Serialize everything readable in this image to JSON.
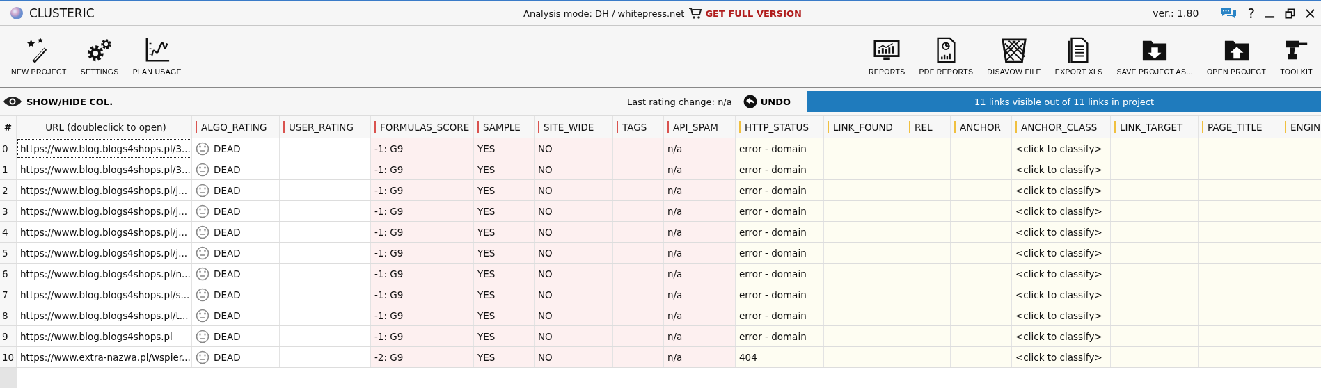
{
  "window": {
    "title": "CLUSTERIC",
    "mode": "Analysis mode: DH / whitepress.net",
    "promo": "GET FULL VERSION",
    "version": "ver.: 1.80",
    "help": "?"
  },
  "toolbar_left": [
    {
      "label": "NEW PROJECT",
      "kind": "wand"
    },
    {
      "label": "SETTINGS",
      "kind": "gears"
    },
    {
      "label": "PLAN USAGE",
      "kind": "chart"
    }
  ],
  "toolbar_right": [
    {
      "label": "REPORTS",
      "kind": "monitor"
    },
    {
      "label": "PDF REPORTS",
      "kind": "pdf"
    },
    {
      "label": "DISAVOW FILE",
      "kind": "bin"
    },
    {
      "label": "EXPORT XLS",
      "kind": "doc"
    },
    {
      "label": "SAVE PROJECT AS...",
      "kind": "save"
    },
    {
      "label": "OPEN PROJECT",
      "kind": "open"
    },
    {
      "label": "TOOLKIT",
      "kind": "drill"
    }
  ],
  "show_hide": "SHOW/HIDE COL.",
  "last_rating": "Last rating change: n/a",
  "undo": "UNDO",
  "links_banner": "11 links visible out of 11 links in project",
  "table": {
    "columns": [
      {
        "label": "#",
        "kind": "index"
      },
      {
        "label": "URL (doubleclick to open)",
        "kind": "plain"
      },
      {
        "label": "ALGO_RATING",
        "kind": "plain",
        "color": "#d9534f"
      },
      {
        "label": "USER_RATING",
        "kind": "plain",
        "color": "#d9534f"
      },
      {
        "label": "FORMULAS_SCORE",
        "kind": "score",
        "color": "#d9534f"
      },
      {
        "label": "SAMPLE",
        "kind": "score",
        "color": "#d9534f"
      },
      {
        "label": "SITE_WIDE",
        "kind": "score",
        "color": "#d9534f"
      },
      {
        "label": "TAGS",
        "kind": "score",
        "color": "#d9534f"
      },
      {
        "label": "API_SPAM",
        "kind": "score",
        "color": "#d9534f"
      },
      {
        "label": "HTTP_STATUS",
        "kind": "crawl",
        "color": "#f0c040"
      },
      {
        "label": "LINK_FOUND",
        "kind": "crawl",
        "color": "#f0c040"
      },
      {
        "label": "REL",
        "kind": "crawl",
        "color": "#f0c040"
      },
      {
        "label": "ANCHOR",
        "kind": "crawl",
        "color": "#f0c040"
      },
      {
        "label": "ANCHOR_CLASS",
        "kind": "crawl",
        "color": "#f0c040"
      },
      {
        "label": "LINK_TARGET",
        "kind": "crawl",
        "color": "#f0c040"
      },
      {
        "label": "PAGE_TITLE",
        "kind": "crawl",
        "color": "#f0c040"
      },
      {
        "label": "ENGIN",
        "kind": "crawl",
        "color": "#f0c040"
      }
    ],
    "rows": [
      {
        "focused": true,
        "cells": [
          "0",
          "https://www.blog.blogs4shops.pl/3...",
          "DEAD",
          "",
          "-1: G9",
          "YES",
          "NO",
          "",
          "n/a",
          "error - domain",
          "",
          "",
          "",
          "<click to classify>",
          "",
          "",
          ""
        ]
      },
      {
        "focused": false,
        "cells": [
          "1",
          "https://www.blog.blogs4shops.pl/3...",
          "DEAD",
          "",
          "-1: G9",
          "YES",
          "NO",
          "",
          "n/a",
          "error - domain",
          "",
          "",
          "",
          "<click to classify>",
          "",
          "",
          ""
        ]
      },
      {
        "focused": false,
        "cells": [
          "2",
          "https://www.blog.blogs4shops.pl/j...",
          "DEAD",
          "",
          "-1: G9",
          "YES",
          "NO",
          "",
          "n/a",
          "error - domain",
          "",
          "",
          "",
          "<click to classify>",
          "",
          "",
          ""
        ]
      },
      {
        "focused": false,
        "cells": [
          "3",
          "https://www.blog.blogs4shops.pl/j...",
          "DEAD",
          "",
          "-1: G9",
          "YES",
          "NO",
          "",
          "n/a",
          "error - domain",
          "",
          "",
          "",
          "<click to classify>",
          "",
          "",
          ""
        ]
      },
      {
        "focused": false,
        "cells": [
          "4",
          "https://www.blog.blogs4shops.pl/j...",
          "DEAD",
          "",
          "-1: G9",
          "YES",
          "NO",
          "",
          "n/a",
          "error - domain",
          "",
          "",
          "",
          "<click to classify>",
          "",
          "",
          ""
        ]
      },
      {
        "focused": false,
        "cells": [
          "5",
          "https://www.blog.blogs4shops.pl/j...",
          "DEAD",
          "",
          "-1: G9",
          "YES",
          "NO",
          "",
          "n/a",
          "error - domain",
          "",
          "",
          "",
          "<click to classify>",
          "",
          "",
          ""
        ]
      },
      {
        "focused": false,
        "cells": [
          "6",
          "https://www.blog.blogs4shops.pl/n...",
          "DEAD",
          "",
          "-1: G9",
          "YES",
          "NO",
          "",
          "n/a",
          "error - domain",
          "",
          "",
          "",
          "<click to classify>",
          "",
          "",
          ""
        ]
      },
      {
        "focused": false,
        "cells": [
          "7",
          "https://www.blog.blogs4shops.pl/s...",
          "DEAD",
          "",
          "-1: G9",
          "YES",
          "NO",
          "",
          "n/a",
          "error - domain",
          "",
          "",
          "",
          "<click to classify>",
          "",
          "",
          ""
        ]
      },
      {
        "focused": false,
        "cells": [
          "8",
          "https://www.blog.blogs4shops.pl/t...",
          "DEAD",
          "",
          "-1: G9",
          "YES",
          "NO",
          "",
          "n/a",
          "error - domain",
          "",
          "",
          "",
          "<click to classify>",
          "",
          "",
          ""
        ]
      },
      {
        "focused": false,
        "cells": [
          "9",
          "https://www.blog.blogs4shops.pl",
          "DEAD",
          "",
          "-1: G9",
          "YES",
          "NO",
          "",
          "n/a",
          "error - domain",
          "",
          "",
          "",
          "<click to classify>",
          "",
          "",
          ""
        ]
      },
      {
        "focused": false,
        "cells": [
          "10",
          "https://www.extra-nazwa.pl/wspier...",
          "DEAD",
          "",
          "-2: G9",
          "YES",
          "NO",
          "",
          "n/a",
          "404",
          "",
          "",
          "",
          "<click to classify>",
          "",
          "",
          ""
        ]
      }
    ]
  }
}
